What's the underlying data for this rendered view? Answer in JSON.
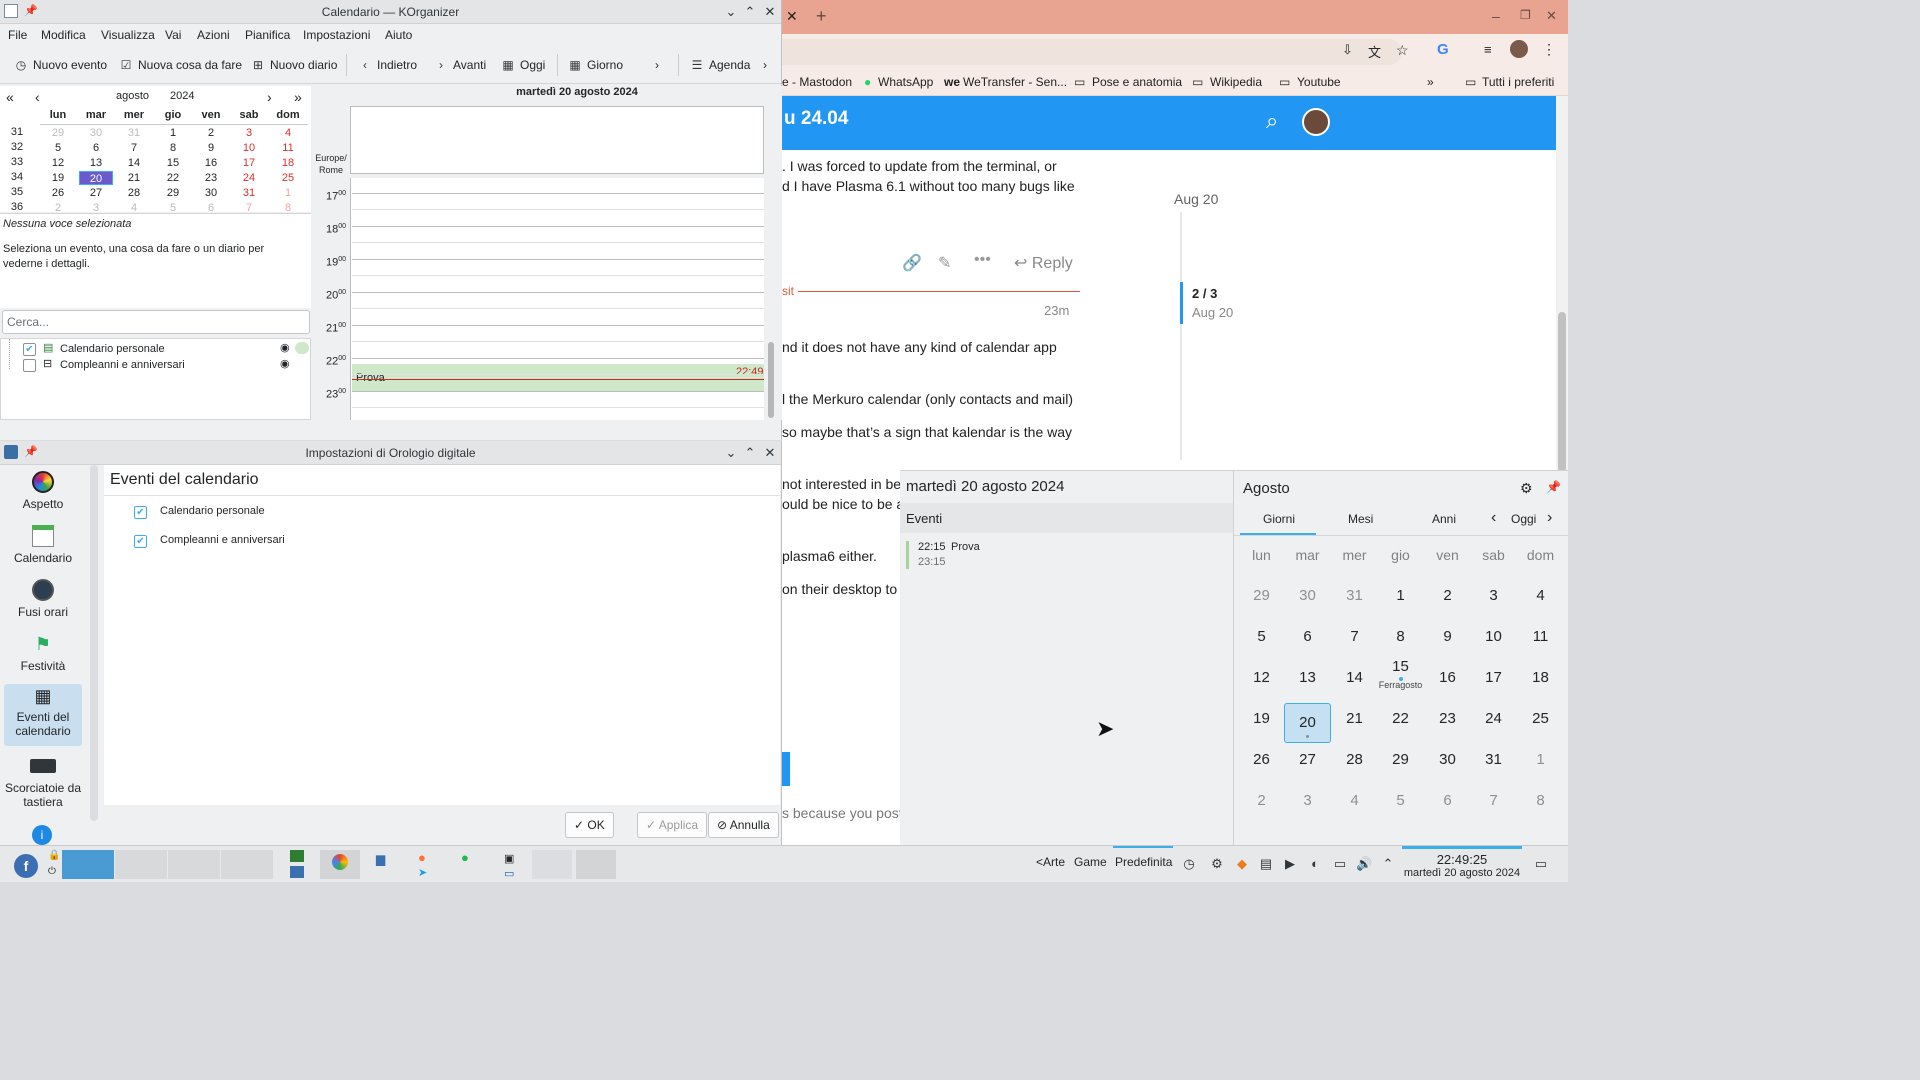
{
  "browser": {
    "bookmarks": [
      "e - Mastodon",
      "WhatsApp",
      "WeTransfer - Sen...",
      "Pose e anatomia",
      "Wikipedia",
      "Youtube",
      "»",
      "Tutti i preferiti"
    ],
    "header_title": "u 24.04",
    "lines": [
      ". I was forced to update from the terminal, or",
      "d I have Plasma 6.1 without too many bugs like",
      "nd it does not have any kind of calendar app",
      "l the Merkuro calendar (only contacts and mail)",
      "so maybe that’s a sign that kalendar is the way",
      "not interested in be",
      "ould be nice to be al",
      " plasma6 either.",
      " on their desktop to",
      "s because you poste"
    ],
    "date_aug20": "Aug 20",
    "reply": "Reply",
    "visit": "sit",
    "time_23m": "23m",
    "timeline_count": "2 / 3",
    "timeline_date": "Aug 20"
  },
  "korg": {
    "title": "Calendario — KOrganizer",
    "menus": [
      "File",
      "Modifica",
      "Visualizza",
      "Vai",
      "Azioni",
      "Pianifica",
      "Impostazioni",
      "Aiuto"
    ],
    "toolbar": [
      "Nuovo evento",
      "Nuova cosa da fare",
      "Nuovo diario",
      "Indietro",
      "Avanti",
      "Oggi",
      "Giorno",
      "Agenda"
    ],
    "month": "agosto",
    "year": "2024",
    "weekdays": [
      "lun",
      "mar",
      "mer",
      "gio",
      "ven",
      "sab",
      "dom"
    ],
    "weeks": [
      "31",
      "32",
      "33",
      "34",
      "35",
      "36"
    ],
    "days": [
      [
        "29",
        "30",
        "31",
        "1",
        "2",
        "3",
        "4"
      ],
      [
        "5",
        "6",
        "7",
        "8",
        "9",
        "10",
        "11"
      ],
      [
        "12",
        "13",
        "14",
        "15",
        "16",
        "17",
        "18"
      ],
      [
        "19",
        "20",
        "21",
        "22",
        "23",
        "24",
        "25"
      ],
      [
        "26",
        "27",
        "28",
        "29",
        "30",
        "31",
        "1"
      ],
      [
        "2",
        "3",
        "4",
        "5",
        "6",
        "7",
        "8"
      ]
    ],
    "no_selection": "Nessuna voce selezionata",
    "hint": "Seleziona un evento, una cosa da fare o un diario per vederne i dettagli.",
    "search_placeholder": "Cerca...",
    "calendars": [
      "Calendario personale",
      "Compleanni e anniversari"
    ],
    "day_header": "martedì 20 agosto 2024",
    "timezone": "Europe/ Rome",
    "hours": [
      "17",
      "18",
      "19",
      "20",
      "21",
      "22",
      "23"
    ],
    "event_title": "Prova",
    "now_time": "22:49",
    "event_color": "#cfe8c9",
    "accent": "#3daee9",
    "today_bg": "#6a5acd"
  },
  "settings": {
    "title": "Impostazioni di Orologio digitale",
    "sidebar": [
      "Aspetto",
      "Calendario",
      "Fusi orari",
      "Festività",
      "Eventi del calendario",
      "Scorciatoie da tastiera"
    ],
    "heading": "Eventi del calendario",
    "plugins": [
      "Calendario personale",
      "Compleanni e anniversari"
    ],
    "ok": "OK",
    "apply": "Applica",
    "cancel": "Annulla"
  },
  "popup": {
    "date": "martedì 20 agosto 2024",
    "events_label": "Eventi",
    "event_start": "22:15",
    "event_name": "Prova",
    "event_end": "23:15",
    "month_title": "Agosto",
    "tabs": [
      "Giorni",
      "Mesi",
      "Anni"
    ],
    "today_btn": "Oggi",
    "weekdays": [
      "lun",
      "mar",
      "mer",
      "gio",
      "ven",
      "sab",
      "dom"
    ],
    "days": [
      [
        "29",
        "30",
        "31",
        "1",
        "2",
        "3",
        "4"
      ],
      [
        "5",
        "6",
        "7",
        "8",
        "9",
        "10",
        "11"
      ],
      [
        "12",
        "13",
        "14",
        "15",
        "16",
        "17",
        "18"
      ],
      [
        "19",
        "20",
        "21",
        "22",
        "23",
        "24",
        "25"
      ],
      [
        "26",
        "27",
        "28",
        "29",
        "30",
        "31",
        "1"
      ],
      [
        "2",
        "3",
        "4",
        "5",
        "6",
        "7",
        "8"
      ]
    ],
    "holiday": "Ferragosto"
  },
  "taskbar": {
    "activities": [
      "<Arte",
      "Game",
      "Predefinita"
    ],
    "time": "22:49:25",
    "date": "martedì 20 agosto 2024"
  }
}
